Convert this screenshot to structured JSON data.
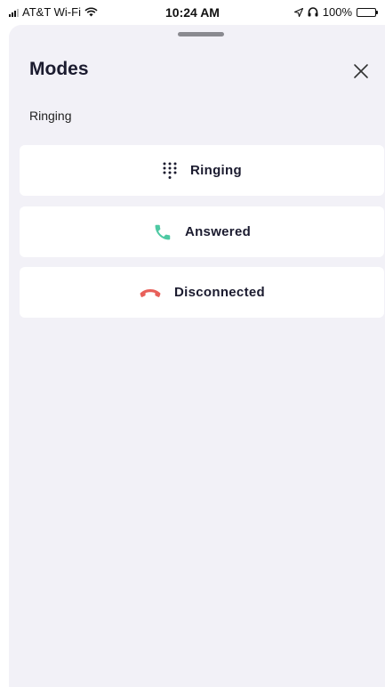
{
  "status_bar": {
    "carrier": "AT&T Wi-Fi",
    "time": "10:24 AM",
    "battery": "100%"
  },
  "sheet": {
    "title": "Modes",
    "current_mode": "Ringing",
    "options": [
      {
        "label": "Ringing",
        "icon": "keypad-dots-icon",
        "color": "#1b1b2f"
      },
      {
        "label": "Answered",
        "icon": "phone-answer-icon",
        "color": "#4ec9a3"
      },
      {
        "label": "Disconnected",
        "icon": "phone-hangup-icon",
        "color": "#e8605a"
      }
    ]
  }
}
